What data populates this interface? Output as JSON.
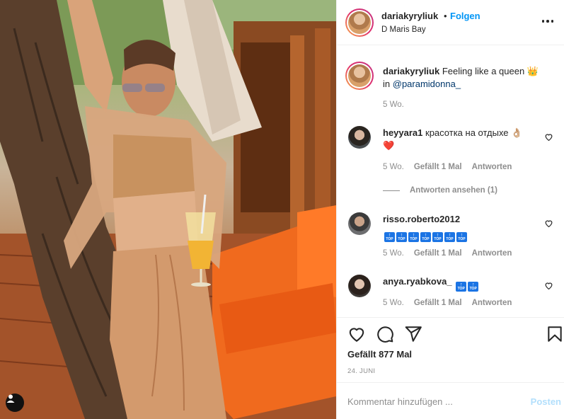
{
  "post": {
    "author": "dariakyryliuk",
    "separator": "•",
    "follow_label": "Folgen",
    "location": "D Maris Bay"
  },
  "caption": {
    "author": "dariakyryliuk",
    "text": "Feeling like a queen",
    "emoji": "👑",
    "in_word": "in",
    "mention": "@paramidonna_",
    "time": "5 Wo."
  },
  "comments": [
    {
      "author": "heyyara1",
      "text": "красотка на отдыхе 👌🏼",
      "text_line2": "❤️",
      "time": "5 Wo.",
      "likes": "Gefällt 1 Mal",
      "reply_label": "Antworten",
      "view_replies": "Antworten ansehen (1)"
    },
    {
      "author": "risso.roberto2012",
      "badges": [
        "TOP",
        "TOP",
        "TOP",
        "TOP",
        "TOP",
        "TOP",
        "TOP"
      ],
      "time": "5 Wo.",
      "likes": "Gefällt 1 Mal",
      "reply_label": "Antworten"
    },
    {
      "author": "anya.ryabkova_",
      "badges": [
        "TOP",
        "TOP"
      ],
      "time": "5 Wo.",
      "likes": "Gefällt 1 Mal",
      "reply_label": "Antworten"
    }
  ],
  "actions": {
    "icons": [
      "heart-icon",
      "comment-icon",
      "share-icon",
      "bookmark-icon"
    ],
    "likes": "Gefällt 877 Mal",
    "date": "24. JUNI"
  },
  "add_comment": {
    "placeholder": "Kommentar hinzufügen ...",
    "post_label": "Posten"
  },
  "colors": {
    "link_blue": "#0095f6",
    "mention": "#00376b",
    "muted": "#8e8e8e",
    "post_disabled": "#b2dffc",
    "badge_blue": "#1b74e4"
  }
}
